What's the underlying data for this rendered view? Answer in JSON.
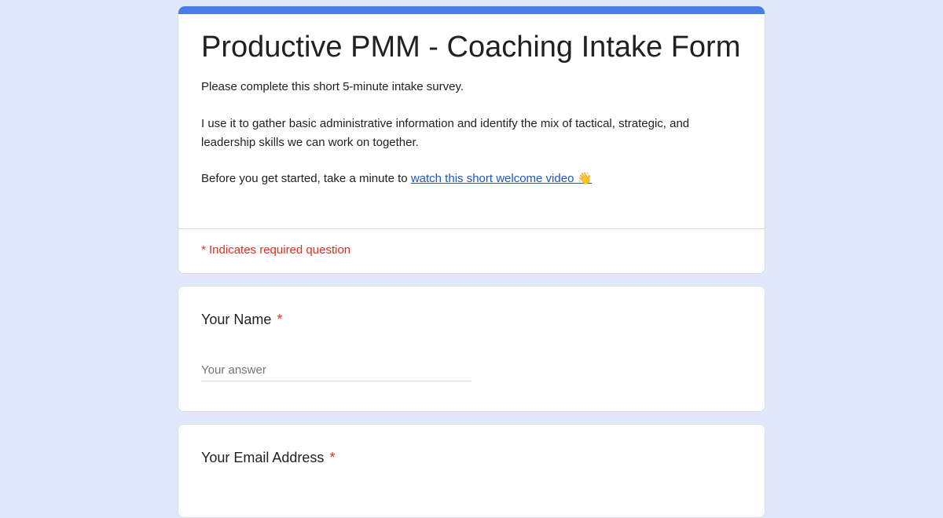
{
  "form": {
    "title": "Productive PMM - Coaching Intake Form",
    "description_1": "Please complete this short 5-minute intake survey.",
    "description_2": "I use it to gather basic administrative information and identify the mix of tactical, strategic, and leadership skills we can work on together.",
    "description_3_prefix": "Before you get started, take a minute to ",
    "welcome_video_link": "watch this short welcome video 👋",
    "required_note": "* Indicates required question"
  },
  "questions": [
    {
      "label": "Your Name",
      "required_marker": "*",
      "placeholder": "Your answer"
    },
    {
      "label": "Your Email Address",
      "required_marker": "*"
    }
  ],
  "colors": {
    "page_background": "#e0e8fb",
    "accent": "#4a7de8",
    "required": "#d93025",
    "link": "#1a56c8"
  }
}
